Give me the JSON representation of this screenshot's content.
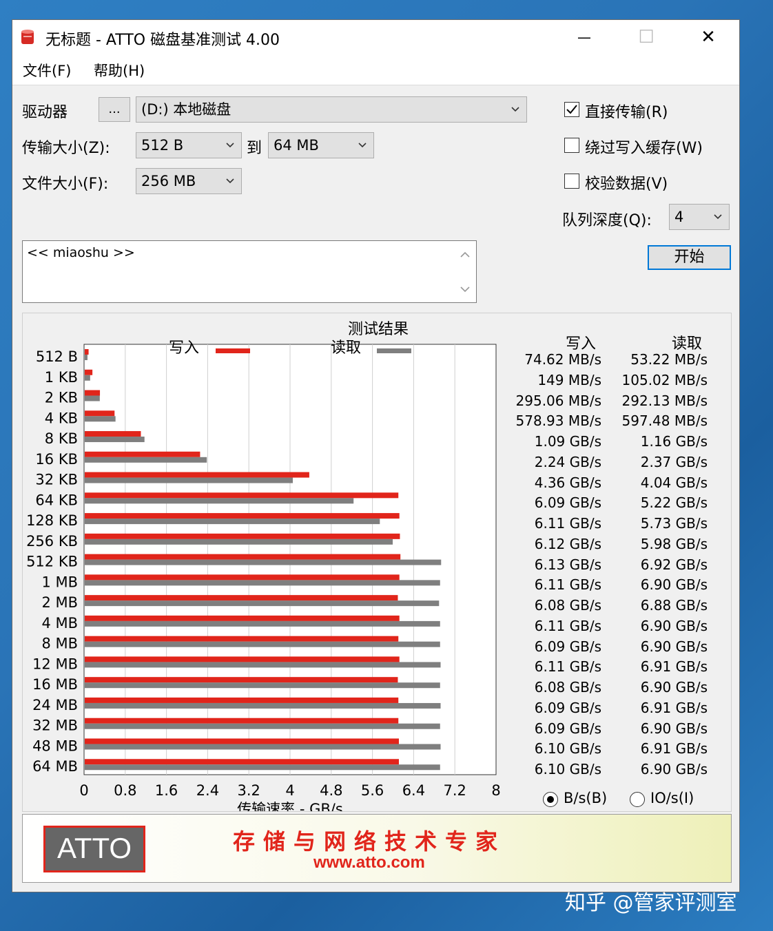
{
  "window": {
    "title": "无标题 - ATTO 磁盘基准测试 4.00",
    "minimize_glyph": "—",
    "maximize_glyph": "☐",
    "close_glyph": "✕"
  },
  "menu": [
    "文件(F)",
    "帮助(H)"
  ],
  "settings": {
    "drive_label": "驱动器",
    "browse_label": "...",
    "drive_value": "(D:) 本地磁盘",
    "transfer_label": "传输大小(Z):",
    "transfer_from": "512 B",
    "to_label": "到",
    "transfer_to": "64 MB",
    "file_size_label": "文件大小(F):",
    "file_size": "256 MB",
    "direct_io_label": "直接传输(R)",
    "direct_io_checked": true,
    "bypass_cache_label": "绕过写入缓存(W)",
    "bypass_cache_checked": false,
    "verify_label": "校验数据(V)",
    "verify_checked": false,
    "queue_label": "队列深度(Q):",
    "queue_value": "4",
    "start_label": "开始",
    "description": "<< miaoshu >>"
  },
  "results": {
    "heading": "测试结果",
    "write_label": "写入",
    "read_label": "读取",
    "write_color": "#e1251b",
    "read_color": "#7f7f7f",
    "units_bytes_label": "B/s(B)",
    "units_io_label": "IO/s(I)",
    "units_selected": "bytes",
    "rows": [
      {
        "size": "512 B",
        "write": "74.62 MB/s",
        "read": "53.22 MB/s"
      },
      {
        "size": "1 KB",
        "write": "149 MB/s",
        "read": "105.02 MB/s"
      },
      {
        "size": "2 KB",
        "write": "295.06 MB/s",
        "read": "292.13 MB/s"
      },
      {
        "size": "4 KB",
        "write": "578.93 MB/s",
        "read": "597.48 MB/s"
      },
      {
        "size": "8 KB",
        "write": "1.09 GB/s",
        "read": "1.16 GB/s"
      },
      {
        "size": "16 KB",
        "write": "2.24 GB/s",
        "read": "2.37 GB/s"
      },
      {
        "size": "32 KB",
        "write": "4.36 GB/s",
        "read": "4.04 GB/s"
      },
      {
        "size": "64 KB",
        "write": "6.09 GB/s",
        "read": "5.22 GB/s"
      },
      {
        "size": "128 KB",
        "write": "6.11 GB/s",
        "read": "5.73 GB/s"
      },
      {
        "size": "256 KB",
        "write": "6.12 GB/s",
        "read": "5.98 GB/s"
      },
      {
        "size": "512 KB",
        "write": "6.13 GB/s",
        "read": "6.92 GB/s"
      },
      {
        "size": "1 MB",
        "write": "6.11 GB/s",
        "read": "6.90 GB/s"
      },
      {
        "size": "2 MB",
        "write": "6.08 GB/s",
        "read": "6.88 GB/s"
      },
      {
        "size": "4 MB",
        "write": "6.11 GB/s",
        "read": "6.90 GB/s"
      },
      {
        "size": "8 MB",
        "write": "6.09 GB/s",
        "read": "6.90 GB/s"
      },
      {
        "size": "12 MB",
        "write": "6.11 GB/s",
        "read": "6.91 GB/s"
      },
      {
        "size": "16 MB",
        "write": "6.08 GB/s",
        "read": "6.90 GB/s"
      },
      {
        "size": "24 MB",
        "write": "6.09 GB/s",
        "read": "6.91 GB/s"
      },
      {
        "size": "32 MB",
        "write": "6.09 GB/s",
        "read": "6.90 GB/s"
      },
      {
        "size": "48 MB",
        "write": "6.10 GB/s",
        "read": "6.91 GB/s"
      },
      {
        "size": "64 MB",
        "write": "6.10 GB/s",
        "read": "6.90 GB/s"
      }
    ]
  },
  "chart_data": {
    "type": "bar",
    "orientation": "horizontal",
    "xlabel": "传输速率 - GB/s",
    "xlim": [
      0,
      8
    ],
    "xticks": [
      "0",
      "0.8",
      "1.6",
      "2.4",
      "3.2",
      "4",
      "4.8",
      "5.6",
      "6.4",
      "7.2",
      "8"
    ],
    "grid": true,
    "categories": [
      "512 B",
      "1 KB",
      "2 KB",
      "4 KB",
      "8 KB",
      "16 KB",
      "32 KB",
      "64 KB",
      "128 KB",
      "256 KB",
      "512 KB",
      "1 MB",
      "2 MB",
      "4 MB",
      "8 MB",
      "12 MB",
      "16 MB",
      "24 MB",
      "32 MB",
      "48 MB",
      "64 MB"
    ],
    "series": [
      {
        "name": "写入",
        "values": [
          0.07462,
          0.149,
          0.29506,
          0.57893,
          1.09,
          2.24,
          4.36,
          6.09,
          6.11,
          6.12,
          6.13,
          6.11,
          6.08,
          6.11,
          6.09,
          6.11,
          6.08,
          6.09,
          6.09,
          6.1,
          6.1
        ]
      },
      {
        "name": "读取",
        "values": [
          0.05322,
          0.10502,
          0.29213,
          0.59748,
          1.16,
          2.37,
          4.04,
          5.22,
          5.73,
          5.98,
          6.92,
          6.9,
          6.88,
          6.9,
          6.9,
          6.91,
          6.9,
          6.91,
          6.9,
          6.91,
          6.9
        ]
      }
    ]
  },
  "banner": {
    "logo": "ATTO",
    "tagline": "存储与网络技术专家",
    "url": "www.atto.com"
  },
  "watermark": "知乎 @管家评测室"
}
